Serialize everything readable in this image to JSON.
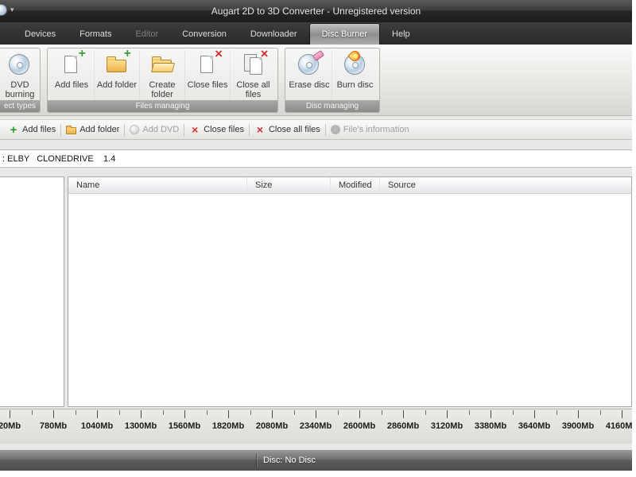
{
  "window": {
    "title": "Augart 2D to 3D Converter - Unregistered version"
  },
  "tab_strip": {
    "tabs": [
      {
        "label": "Devices",
        "state": "normal"
      },
      {
        "label": "Formats",
        "state": "normal"
      },
      {
        "label": "Editor",
        "state": "disabled"
      },
      {
        "label": "Conversion",
        "state": "normal"
      },
      {
        "label": "Downloader",
        "state": "normal"
      },
      {
        "label": "Disc Burner",
        "state": "active"
      },
      {
        "label": "Help",
        "state": "normal"
      }
    ]
  },
  "ribbon": {
    "groups": [
      {
        "name": "project-types",
        "label": "ect types",
        "buttons": [
          {
            "label": "DVD burning",
            "icon": "dvd-burning"
          }
        ]
      },
      {
        "name": "files-managing",
        "label": "Files managing",
        "buttons": [
          {
            "label": "Add files",
            "icon": "add-files"
          },
          {
            "label": "Add folder",
            "icon": "add-folder"
          },
          {
            "label": "Create folder",
            "icon": "create-folder"
          },
          {
            "label": "Close files",
            "icon": "close-files"
          },
          {
            "label": "Close all files",
            "icon": "close-all-files"
          }
        ]
      },
      {
        "name": "disc-managing",
        "label": "Disc managing",
        "buttons": [
          {
            "label": "Erase disc",
            "icon": "erase-disc"
          },
          {
            "label": "Burn disc",
            "icon": "burn-disc"
          }
        ]
      }
    ]
  },
  "quick_toolbar": {
    "items": [
      {
        "label": "Add files",
        "icon": "plus",
        "disabled": false
      },
      {
        "label": "Add folder",
        "icon": "folder",
        "disabled": false
      },
      {
        "label": "Add DVD",
        "icon": "disc",
        "disabled": true
      },
      {
        "label": "Close files",
        "icon": "close",
        "disabled": false
      },
      {
        "label": "Close all files",
        "icon": "close",
        "disabled": false
      },
      {
        "label": "File's information",
        "icon": "info",
        "disabled": true
      }
    ]
  },
  "drive_selector": {
    "value": ": ELBY   CLONEDRIVE    1.4"
  },
  "file_list": {
    "columns": [
      "Name",
      "Size",
      "Modified",
      "Source"
    ],
    "rows": []
  },
  "capacity_ruler": {
    "unit": "Mb",
    "labels": [
      "20Mb",
      "780Mb",
      "1040Mb",
      "1300Mb",
      "1560Mb",
      "1820Mb",
      "2080Mb",
      "2340Mb",
      "2600Mb",
      "2860Mb",
      "3120Mb",
      "3380Mb",
      "3640Mb",
      "3900Mb",
      "4160Mb"
    ]
  },
  "status_bar": {
    "disc_status": "Disc: No Disc"
  }
}
